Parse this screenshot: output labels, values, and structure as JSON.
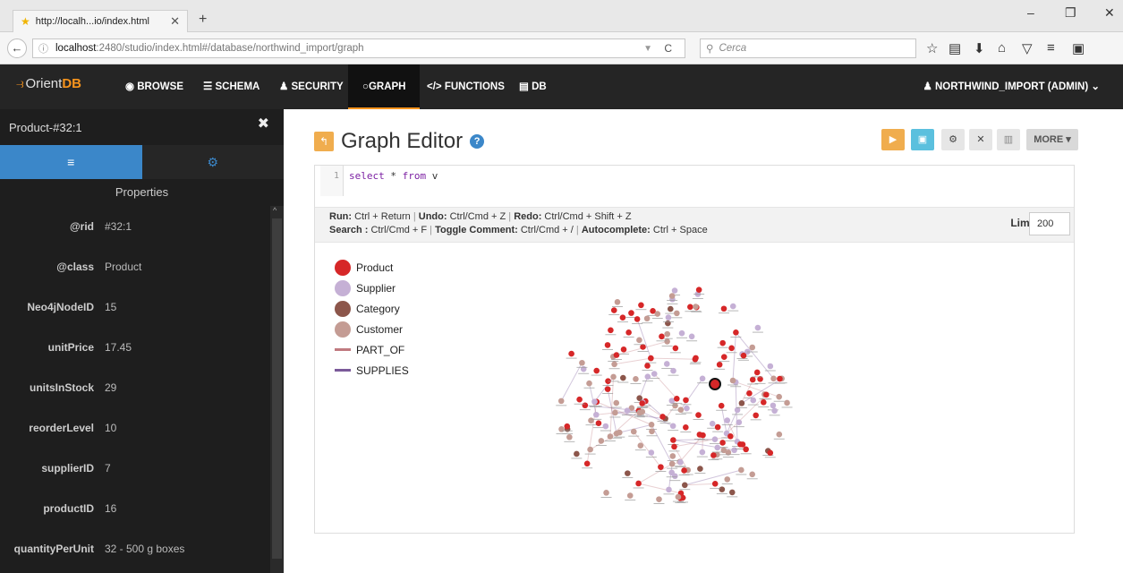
{
  "browser": {
    "tab_title": "http://localh...io/index.html",
    "new_tab": "+",
    "url_host": "localhost",
    "url_rest": ":2480/studio/index.html#/database/northwind_import/graph",
    "search_placeholder": "Cerca"
  },
  "app": {
    "logo_prefix": "Orient",
    "logo_suffix": "DB",
    "nav": [
      {
        "label": "BROWSE",
        "icon": "eye-icon"
      },
      {
        "label": "SCHEMA",
        "icon": "list-icon"
      },
      {
        "label": "SECURITY",
        "icon": "user-icon"
      },
      {
        "label": "GRAPH",
        "icon": "circle-icon",
        "active": true
      },
      {
        "label": "FUNCTIONS",
        "icon": "code-icon"
      },
      {
        "label": "DB",
        "icon": "database-icon"
      }
    ],
    "user_label": "NORTHWIND_IMPORT (ADMIN)"
  },
  "sidebar": {
    "title": "Product-#32:1",
    "properties_title": "Properties",
    "properties": [
      {
        "key": "@rid",
        "value": "#32:1"
      },
      {
        "key": "@class",
        "value": "Product"
      },
      {
        "key": "Neo4jNodeID",
        "value": "15"
      },
      {
        "key": "unitPrice",
        "value": "17.45"
      },
      {
        "key": "unitsInStock",
        "value": "29"
      },
      {
        "key": "reorderLevel",
        "value": "10"
      },
      {
        "key": "supplierID",
        "value": "7"
      },
      {
        "key": "productID",
        "value": "16"
      },
      {
        "key": "quantityPerUnit",
        "value": "32 - 500 g boxes"
      }
    ]
  },
  "editor": {
    "title": "Graph Editor",
    "line_number": "1",
    "query_select": "select",
    "query_star": " * ",
    "query_from": "from",
    "query_v": " v",
    "more_label": "MORE",
    "hints_line1": [
      {
        "k": "Run:",
        "v": " Ctrl + Return"
      },
      {
        "k": "Undo:",
        "v": " Ctrl/Cmd + Z"
      },
      {
        "k": "Redo:",
        "v": " Ctrl/Cmd + Shift + Z"
      }
    ],
    "hints_line2": [
      {
        "k": "Search :",
        "v": " Ctrl/Cmd + F"
      },
      {
        "k": "Toggle Comment:",
        "v": " Ctrl/Cmd + /"
      },
      {
        "k": "Autocomplete:",
        "v": " Ctrl + Space"
      }
    ],
    "limit_label": "Limit",
    "limit_value": "200"
  },
  "legend": [
    {
      "label": "Product",
      "kind": "node",
      "color": "#d62728"
    },
    {
      "label": "Supplier",
      "kind": "node",
      "color": "#c5b0d5"
    },
    {
      "label": "Category",
      "kind": "node",
      "color": "#8c564b"
    },
    {
      "label": "Customer",
      "kind": "node",
      "color": "#c49c94"
    },
    {
      "label": "PART_OF",
      "kind": "edge",
      "color": "#c07a80"
    },
    {
      "label": "SUPPLIES",
      "kind": "edge",
      "color": "#7b5a9a"
    }
  ],
  "colors": {
    "accent": "#f7941d",
    "primary": "#3b87c9",
    "nav_bg": "#252525",
    "sidebar_bg": "#1e1e1e"
  }
}
